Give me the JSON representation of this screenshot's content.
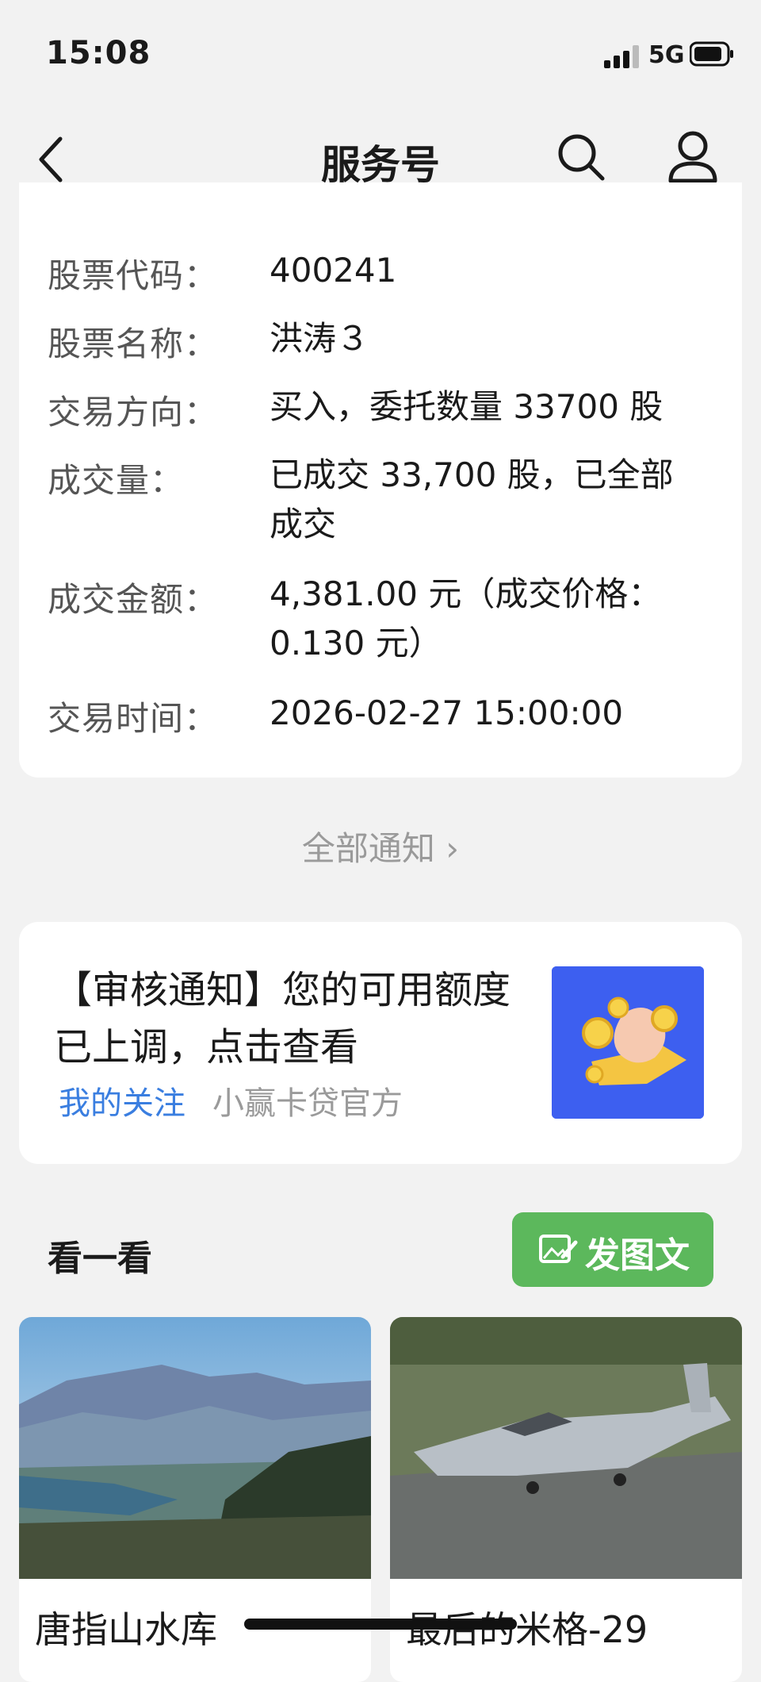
{
  "status_bar": {
    "time": "15:08",
    "network": "5G"
  },
  "nav": {
    "title": "服务号"
  },
  "notice": {
    "rows": [
      {
        "label": "股票代码：",
        "value": "400241"
      },
      {
        "label": "股票名称：",
        "value": "洪涛３"
      },
      {
        "label": "交易方向：",
        "value": "买入，委托数量 33700 股"
      },
      {
        "label": "成交量：",
        "value": "已成交 33,700 股，已全部成交"
      },
      {
        "label": "成交金额：",
        "value": "4,381.00 元（成交价格：0.130 元）"
      },
      {
        "label": "交易时间：",
        "value": "2026-02-27 15:00:00"
      }
    ],
    "all_link": "全部通知 ›"
  },
  "promo": {
    "title": "【审核通知】您的可用额度已上调，点击查看",
    "follow_tag": "我的关注",
    "source": "小赢卡贷官方"
  },
  "section": {
    "title": "看一看",
    "post_button": "发图文"
  },
  "feed": [
    {
      "title": "唐指山水库"
    },
    {
      "title": "最后的米格-29"
    }
  ],
  "colors": {
    "accent_green": "#5cb85c",
    "link_blue": "#3a7ee0",
    "promo_blue": "#3d5ff0"
  }
}
